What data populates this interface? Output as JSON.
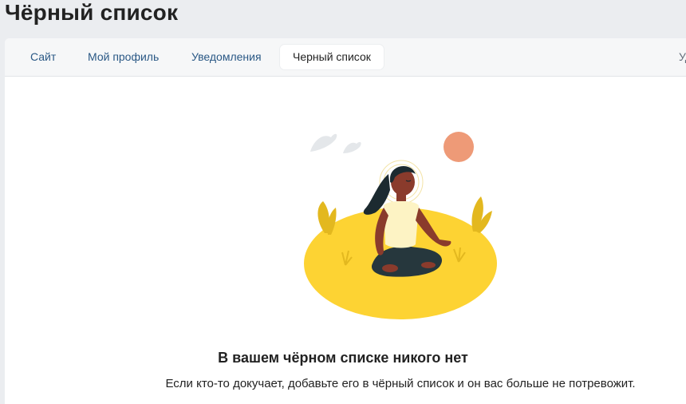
{
  "page": {
    "title": "Чёрный список"
  },
  "tabs": [
    {
      "label": "Сайт",
      "active": false
    },
    {
      "label": "Мой профиль",
      "active": false
    },
    {
      "label": "Уведомления",
      "active": false
    },
    {
      "label": "Черный список",
      "active": true
    },
    {
      "label": "Уд",
      "active": false
    }
  ],
  "empty_state": {
    "title": "В вашем чёрном списке никого нет",
    "subtitle": "Если кто-то докучает, добавьте его в чёрный список и он вас больше не потревожит."
  },
  "colors": {
    "link": "#2a5885",
    "ground": "#fdd333",
    "sun": "#ee9a77",
    "skin": "#8a3b2c",
    "shirt": "#fdf3c4",
    "pants": "#26373d",
    "hair": "#1c2a30"
  }
}
